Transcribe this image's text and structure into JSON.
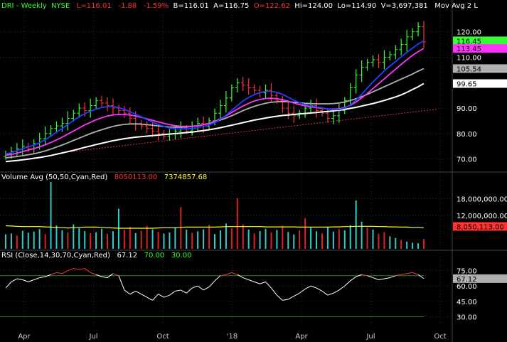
{
  "header": {
    "symbol": "DRI - Weekly",
    "exchange": "NYSE",
    "last": "L=116.01",
    "change": "-1.88",
    "change_pct": "-1.59%",
    "bid": "B=116.01",
    "ask": "A=116.75",
    "open": "O=122.62",
    "high": "Hi=124.00",
    "low": "Lo=114.90",
    "volume": "V=3,697,381",
    "mov_avg": "Mov Avg 2 L"
  },
  "volume_header": {
    "label": "Volume Avg (50,50,Cyan,Red)",
    "v1": "8050113.00",
    "v2": "7374857.68"
  },
  "rsi_header": {
    "label": "RSI (Close,14,30,70,Cyan,Red)",
    "v1": "67.12",
    "v2": "70.00",
    "v3": "30.00"
  },
  "colors": {
    "background": "#000000",
    "grid": "#2a2a2a",
    "up": "#33ff33",
    "down": "#ff3333",
    "ma_blue": "#2040ff",
    "ma_magenta": "#ff33ff",
    "ma_gray": "#b0b0b0",
    "ma_white": "#ffffff",
    "vol_cyan": "#33cccc",
    "vol_red": "#dd2222",
    "vol_avg": "#ffff33",
    "rsi_line": "#ffffff",
    "rsi_band": "#228822",
    "rsi_current": "#ff3333",
    "trendline": "#dd3333"
  },
  "chart_data": [
    {
      "type": "candlestick",
      "panel": "price",
      "y_ticks": [
        "120.00",
        "110.00",
        "90.00",
        "80.00",
        "70.00"
      ],
      "ylim": [
        66,
        128
      ],
      "price_labels": [
        {
          "text": "116.45",
          "value": 116.45,
          "bg": "#33ff33",
          "fg": "#000000"
        },
        {
          "text": "113.45",
          "value": 113.45,
          "bg": "#ff33ff",
          "fg": "#000000"
        },
        {
          "text": "105.54",
          "value": 105.54,
          "bg": "#b0b0b0",
          "fg": "#000000"
        },
        {
          "text": "99.65",
          "value": 99.65,
          "bg": "#ffffff",
          "fg": "#000000"
        }
      ],
      "close": [
        72,
        73,
        74,
        75,
        74,
        76,
        78,
        80,
        82,
        83,
        84,
        86,
        88,
        90,
        89,
        91,
        93,
        92,
        91,
        90,
        89,
        88,
        86,
        84,
        83,
        82,
        81,
        80,
        79,
        80,
        81,
        82,
        81,
        83,
        84,
        83,
        85,
        88,
        91,
        94,
        98,
        100,
        99,
        98,
        97,
        96,
        97,
        95,
        93,
        90,
        88,
        87,
        88,
        90,
        91,
        89,
        88,
        86,
        87,
        89,
        93,
        98,
        103,
        106,
        108,
        109,
        108,
        110,
        111,
        113,
        115,
        118,
        120,
        122,
        116
      ],
      "ma_blue": [
        72,
        72.5,
        73.3,
        74.1,
        74.8,
        75.5,
        76.4,
        77.6,
        79,
        80.6,
        82,
        83.6,
        85.1,
        86.6,
        87.8,
        88.8,
        89.6,
        90.2,
        90.6,
        90.6,
        90.2,
        89.5,
        88.6,
        87.6,
        86.6,
        85.5,
        84.5,
        83.6,
        82.8,
        82.2,
        81.9,
        81.8,
        81.8,
        82,
        82.4,
        82.8,
        83.4,
        84.3,
        85.6,
        87.2,
        89.1,
        91,
        92.8,
        94.2,
        95.3,
        96.1,
        96.6,
        96.6,
        96.2,
        95.4,
        94.3,
        93.1,
        92.1,
        91.4,
        90.9,
        90.5,
        90.1,
        89.7,
        89.4,
        89.4,
        90,
        91.3,
        93.2,
        95.4,
        97.9,
        100.3,
        102.5,
        104.6,
        106.5,
        108.3,
        110.1,
        111.9,
        113.6,
        115.2,
        116.45
      ],
      "ma_magenta": [
        71.5,
        71.8,
        72.3,
        72.9,
        73.5,
        74.1,
        74.8,
        75.6,
        76.5,
        77.5,
        78.6,
        79.8,
        81,
        82.2,
        83.4,
        84.4,
        85.4,
        86.2,
        86.9,
        87.3,
        87.5,
        87.5,
        87.3,
        86.9,
        86.4,
        85.8,
        85.2,
        84.6,
        84,
        83.5,
        83.1,
        82.9,
        82.8,
        82.9,
        83.1,
        83.5,
        84,
        84.8,
        85.8,
        87,
        88.3,
        89.6,
        90.8,
        91.9,
        92.8,
        93.4,
        93.8,
        93.9,
        93.7,
        93.3,
        92.7,
        92,
        91.4,
        90.9,
        90.5,
        90.2,
        89.9,
        89.7,
        89.6,
        89.7,
        90.2,
        91.1,
        92.4,
        94,
        95.8,
        97.7,
        99.6,
        101.5,
        103.4,
        105.3,
        107.2,
        109,
        110.7,
        112.2,
        113.45
      ],
      "ma_gray": [
        70.5,
        70.7,
        71,
        71.3,
        71.7,
        72.1,
        72.6,
        73.2,
        73.9,
        74.7,
        75.5,
        76.4,
        77.3,
        78.2,
        79.1,
        80,
        80.8,
        81.5,
        82.2,
        82.8,
        83.3,
        83.6,
        83.8,
        83.8,
        83.7,
        83.5,
        83.3,
        83,
        82.8,
        82.6,
        82.5,
        82.5,
        82.6,
        82.8,
        83.1,
        83.5,
        84,
        84.6,
        85.3,
        86.1,
        87,
        88,
        89,
        89.9,
        90.7,
        91.4,
        91.9,
        92.3,
        92.5,
        92.6,
        92.5,
        92.3,
        92.1,
        91.9,
        91.8,
        91.7,
        91.7,
        91.7,
        91.8,
        92,
        92.4,
        93,
        93.7,
        94.5,
        95.4,
        96.4,
        97.4,
        98.4,
        99.4,
        100.4,
        101.4,
        102.4,
        103.4,
        104.5,
        105.54
      ],
      "ma_white": [
        69,
        69.2,
        69.4,
        69.7,
        70,
        70.3,
        70.6,
        71,
        71.4,
        71.9,
        72.4,
        72.9,
        73.4,
        74,
        74.6,
        75.1,
        75.7,
        76.2,
        76.7,
        77.2,
        77.6,
        78,
        78.3,
        78.6,
        78.8,
        79,
        79.2,
        79.4,
        79.6,
        79.8,
        80,
        80.2,
        80.4,
        80.6,
        80.9,
        81.2,
        81.5,
        81.9,
        82.3,
        82.8,
        83.3,
        83.8,
        84.3,
        84.8,
        85.3,
        85.7,
        86.1,
        86.5,
        86.8,
        87.1,
        87.3,
        87.5,
        87.7,
        87.9,
        88.1,
        88.3,
        88.5,
        88.7,
        88.9,
        89.2,
        89.5,
        89.9,
        90.3,
        90.8,
        91.3,
        91.8,
        92.4,
        93,
        93.7,
        94.4,
        95.2,
        96.2,
        97.3,
        98.4,
        99.65
      ],
      "trendline": [
        [
          10,
          72.5
        ],
        [
          74,
          89
        ]
      ]
    },
    {
      "type": "bar",
      "panel": "volume",
      "y_ticks": [
        "18,000,000.00",
        "12,000,000.00"
      ],
      "ylim": [
        0,
        24000000
      ],
      "avg_value": 8050113,
      "avg_label": "8,050,113.00",
      "avg_line": [
        8.3,
        8.2,
        8.1,
        8.0,
        8.0,
        8.0,
        8.0,
        7.9,
        7.8,
        7.7,
        7.6,
        7.5,
        7.6,
        7.7,
        7.8,
        7.8,
        7.8,
        7.7,
        7.6,
        7.5,
        7.4,
        7.4,
        7.4,
        7.4,
        7.4,
        7.4,
        7.4,
        7.5,
        7.6,
        7.6,
        7.6,
        7.7,
        7.8,
        7.8,
        7.8,
        7.8,
        7.8,
        7.8,
        7.9,
        8.0,
        8.0,
        8.0,
        8.0,
        8.0,
        8.0,
        8.0,
        7.9,
        7.9,
        7.9,
        7.9,
        7.9,
        7.9,
        7.8,
        7.8,
        7.8,
        7.8,
        7.8,
        7.8,
        7.9,
        7.9,
        8.0,
        8.0,
        8.1,
        8.1,
        8.1,
        8.1,
        8.0,
        8.0,
        7.9,
        7.9,
        7.8,
        7.8,
        7.7,
        7.7,
        7.6
      ],
      "bars": [
        [
          5.2,
          "c"
        ],
        [
          5.5,
          "c"
        ],
        [
          4.8,
          "r"
        ],
        [
          6.5,
          "c"
        ],
        [
          5.8,
          "c"
        ],
        [
          6.2,
          "c"
        ],
        [
          7.1,
          "c"
        ],
        [
          5.3,
          "r"
        ],
        [
          24.0,
          "c"
        ],
        [
          8.4,
          "c"
        ],
        [
          6.7,
          "c"
        ],
        [
          5.9,
          "r"
        ],
        [
          8.8,
          "c"
        ],
        [
          7.4,
          "c"
        ],
        [
          6.4,
          "c"
        ],
        [
          5.6,
          "r"
        ],
        [
          6.0,
          "c"
        ],
        [
          7.2,
          "c"
        ],
        [
          5.4,
          "r"
        ],
        [
          6.3,
          "c"
        ],
        [
          14.4,
          "c"
        ],
        [
          6.8,
          "r"
        ],
        [
          7.9,
          "r"
        ],
        [
          5.7,
          "c"
        ],
        [
          6.5,
          "r"
        ],
        [
          8.2,
          "r"
        ],
        [
          7.0,
          "c"
        ],
        [
          6.1,
          "r"
        ],
        [
          5.5,
          "c"
        ],
        [
          5.9,
          "c"
        ],
        [
          7.6,
          "c"
        ],
        [
          15.0,
          "r"
        ],
        [
          6.9,
          "c"
        ],
        [
          5.8,
          "r"
        ],
        [
          6.3,
          "c"
        ],
        [
          7.0,
          "c"
        ],
        [
          8.6,
          "r"
        ],
        [
          5.3,
          "c"
        ],
        [
          6.6,
          "c"
        ],
        [
          9.1,
          "c"
        ],
        [
          7.4,
          "r"
        ],
        [
          18.2,
          "r"
        ],
        [
          8.8,
          "r"
        ],
        [
          6.9,
          "c"
        ],
        [
          5.5,
          "r"
        ],
        [
          6.4,
          "c"
        ],
        [
          7.2,
          "c"
        ],
        [
          5.9,
          "r"
        ],
        [
          6.8,
          "c"
        ],
        [
          8.3,
          "r"
        ],
        [
          6.1,
          "c"
        ],
        [
          5.2,
          "c"
        ],
        [
          6.7,
          "r"
        ],
        [
          11.0,
          "r"
        ],
        [
          7.6,
          "c"
        ],
        [
          6.3,
          "c"
        ],
        [
          5.5,
          "r"
        ],
        [
          8.0,
          "c"
        ],
        [
          6.2,
          "c"
        ],
        [
          7.1,
          "r"
        ],
        [
          6.6,
          "c"
        ],
        [
          8.5,
          "c"
        ],
        [
          17.4,
          "c"
        ],
        [
          9.8,
          "c"
        ],
        [
          7.6,
          "r"
        ],
        [
          6.9,
          "c"
        ],
        [
          5.4,
          "r"
        ],
        [
          6.0,
          "r"
        ],
        [
          4.5,
          "c"
        ],
        [
          3.9,
          "c"
        ],
        [
          3.2,
          "r"
        ],
        [
          2.6,
          "c"
        ],
        [
          2.2,
          "c"
        ],
        [
          2.0,
          "c"
        ],
        [
          3.5,
          "r"
        ]
      ]
    },
    {
      "type": "line",
      "panel": "rsi",
      "y_ticks": [
        "75.00",
        "60.00",
        "45.00",
        "30.00"
      ],
      "ylim": [
        20,
        85
      ],
      "overbought": 70,
      "oversold": 30,
      "current_label": "67.12",
      "values": [
        58,
        64,
        67,
        66,
        64,
        66,
        68,
        69,
        71,
        73,
        72,
        75,
        77,
        76,
        77,
        73,
        71,
        69,
        68,
        72,
        70,
        56,
        52,
        55,
        52,
        49,
        46,
        52,
        49,
        51,
        55,
        56,
        53,
        58,
        60,
        56,
        59,
        65,
        70,
        71,
        73,
        71,
        68,
        66,
        64,
        62,
        64,
        58,
        51,
        46,
        47,
        50,
        53,
        57,
        60,
        58,
        55,
        51,
        53,
        56,
        60,
        65,
        69,
        71,
        70,
        68,
        66,
        67,
        68,
        70,
        71,
        72,
        73,
        71,
        67.12
      ]
    }
  ],
  "x_axis": {
    "labels": [
      "Apr",
      "Jul",
      "Oct",
      "'18",
      "Apr",
      "Jul",
      "Oct"
    ]
  }
}
